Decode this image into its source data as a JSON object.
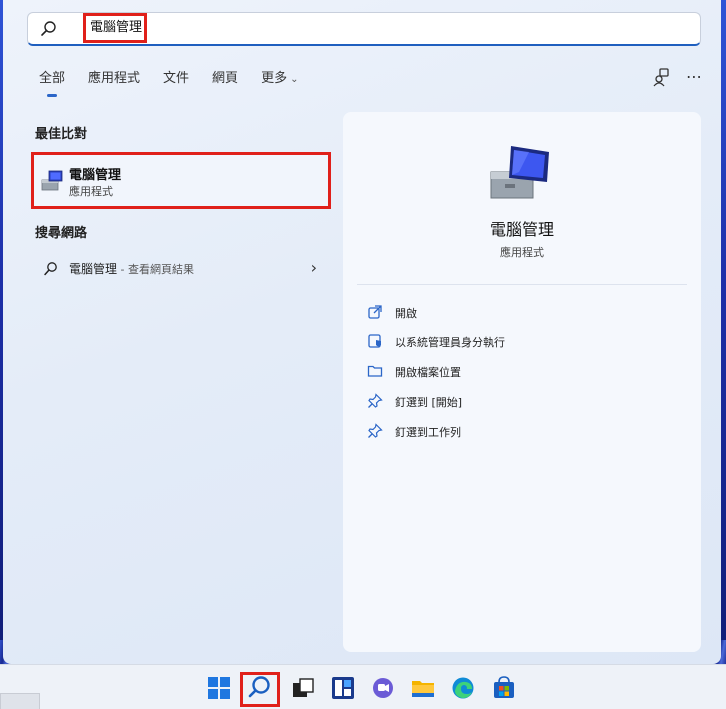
{
  "search": {
    "query": "電腦管理"
  },
  "tabs": [
    {
      "label": "全部"
    },
    {
      "label": "應用程式"
    },
    {
      "label": "文件"
    },
    {
      "label": "網頁"
    },
    {
      "label": "更多"
    }
  ],
  "sections": {
    "best_match": "最佳比對",
    "web": "搜尋網路"
  },
  "best_match": {
    "name": "電腦管理",
    "type": "應用程式"
  },
  "web_result": {
    "term": "電腦管理",
    "suffix": " - 查看網頁結果"
  },
  "detail": {
    "title": "電腦管理",
    "type": "應用程式",
    "actions": [
      {
        "label": "開啟",
        "icon": "open-external-icon"
      },
      {
        "label": "以系統管理員身分執行",
        "icon": "shield-icon"
      },
      {
        "label": "開啟檔案位置",
        "icon": "folder-icon"
      },
      {
        "label": "釘選到 [開始]",
        "icon": "pin-icon"
      },
      {
        "label": "釘選到工作列",
        "icon": "pin-icon"
      }
    ]
  },
  "colors": {
    "accent": "#2b66c8",
    "highlight": "#e0201a"
  }
}
